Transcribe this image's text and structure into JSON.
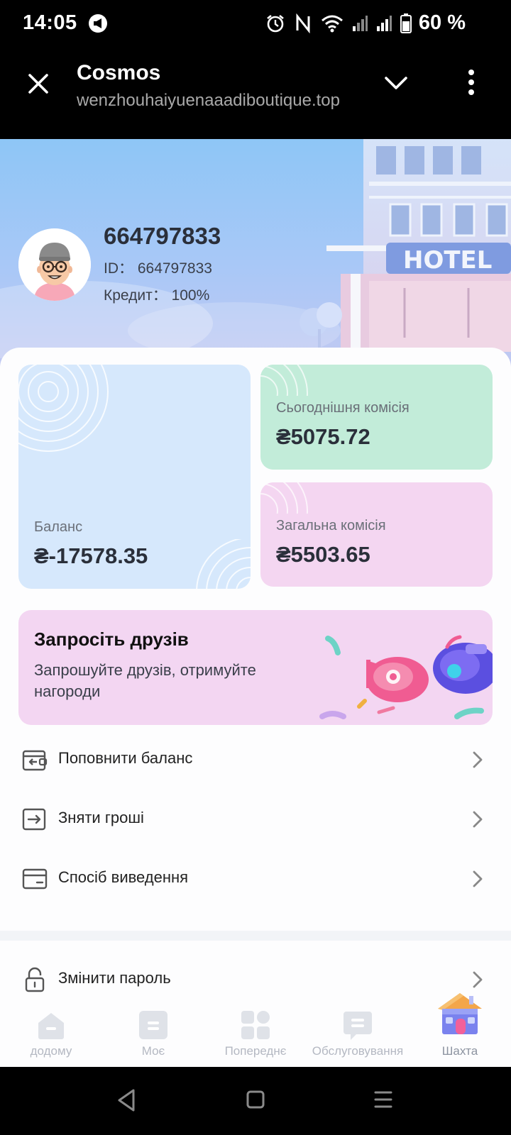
{
  "status_bar": {
    "time": "14:05",
    "battery": "60 %",
    "icons": [
      "alarm-icon",
      "nfc-icon",
      "wifi-icon",
      "signal-icon",
      "signal-icon",
      "battery-icon"
    ]
  },
  "browser": {
    "title": "Cosmos",
    "url": "wenzhouhaiyuenaaadiboutique.top"
  },
  "profile": {
    "name": "664797833",
    "id_label": "ID： 664797833",
    "credit_label": "Кредит： 100%"
  },
  "hero": {
    "sign": "HOTEL"
  },
  "balance_cards": {
    "balance": {
      "label": "Баланс",
      "value": "₴-17578.35"
    },
    "today": {
      "label": "Сьогоднішня комісія",
      "value": "₴5075.72"
    },
    "total": {
      "label": "Загальна комісія",
      "value": "₴5503.65"
    }
  },
  "invite": {
    "title": "Запросіть друзів",
    "description": "Запрошуйте друзів, отримуйте нагороди"
  },
  "menu": [
    {
      "label": "Поповнити баланс",
      "icon": "wallet-in-icon"
    },
    {
      "label": "Зняти гроші",
      "icon": "withdraw-icon"
    },
    {
      "label": "Спосіб виведення",
      "icon": "card-icon"
    },
    {
      "label": "Змінити пароль",
      "icon": "lock-icon"
    }
  ],
  "tabs": [
    {
      "label": "додому",
      "icon": "home-icon"
    },
    {
      "label": "Моє",
      "icon": "profile-icon"
    },
    {
      "label": "Попереднє",
      "icon": "grid-icon"
    },
    {
      "label": "Обслуговування",
      "icon": "chat-icon"
    },
    {
      "label": "Шахта",
      "icon": "house-icon"
    }
  ],
  "colors": {
    "balance_card": "#d6e8fc",
    "today_card": "#c2ecd9",
    "total_card": "#f4d6f1",
    "invite_banner": "#f3d6f2"
  }
}
